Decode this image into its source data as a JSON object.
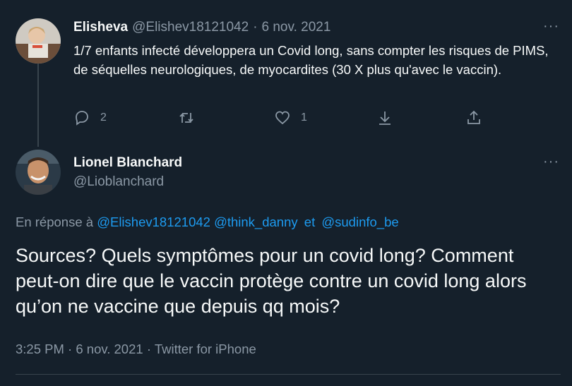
{
  "tweet1": {
    "name": "Elisheva",
    "handle": "@Elishev18121042",
    "sep": "·",
    "date": "6 nov. 2021",
    "more": "···",
    "text": "1/7 enfants infecté développera un Covid long, sans compter les risques de PIMS, de séquelles neurologiques, de myocardites (30 X plus qu'avec le vaccin).",
    "replies": "2",
    "likes": "1"
  },
  "tweet2": {
    "name": "Lionel Blanchard",
    "handle": "@Lioblanchard",
    "more": "···",
    "reply_prefix": "En réponse à",
    "mention1": "@Elishev18121042",
    "mention2": "@think_danny",
    "and": "et",
    "mention3": "@sudinfo_be",
    "text": "Sources? Quels symptômes pour un covid long? Comment peut-on dire que le vaccin protège contre un covid long alors qu’on ne vaccine que depuis qq mois?",
    "time": "3:25 PM",
    "sep": "·",
    "date": "6 nov. 2021",
    "sep2": "·",
    "source": "Twitter for iPhone"
  },
  "colors": {
    "background": "#15202b",
    "accent": "#1d9bf0",
    "muted": "#8b98a5",
    "text": "#f7f9f9"
  },
  "icons": [
    "reply-icon",
    "retweet-icon",
    "like-icon",
    "download-icon",
    "share-icon",
    "more-icon"
  ]
}
